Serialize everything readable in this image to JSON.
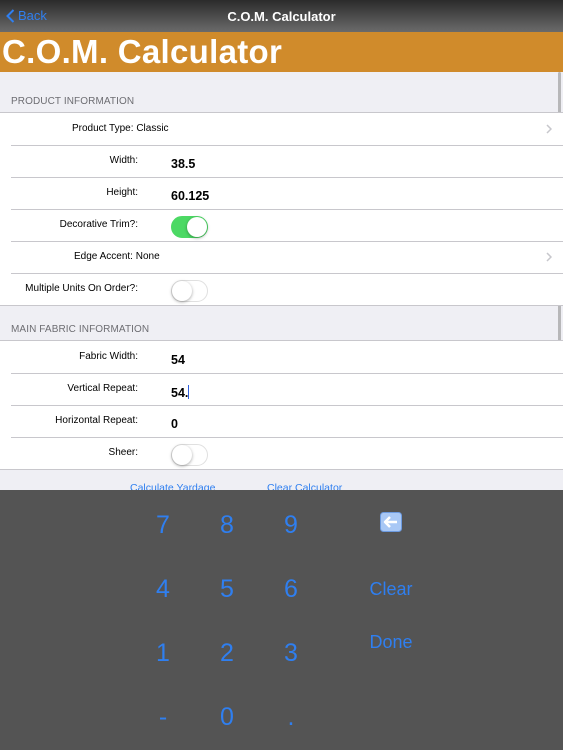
{
  "navbar": {
    "back_label": "Back",
    "title": "C.O.M. Calculator"
  },
  "banner": {
    "title": "C.O.M. Calculator",
    "color": "#d08b2b"
  },
  "product_section": {
    "header": "PRODUCT INFORMATION",
    "product_type_label": "Product Type:",
    "product_type_value": "Classic",
    "width_label": "Width:",
    "width_value": "38.5",
    "height_label": "Height:",
    "height_value": "60.125",
    "decorative_trim_label": "Decorative Trim?:",
    "decorative_trim_on": true,
    "edge_accent_label": "Edge Accent:",
    "edge_accent_value": "None",
    "multiple_units_label": "Multiple Units On Order?:",
    "multiple_units_on": false
  },
  "fabric_section": {
    "header": "MAIN FABRIC INFORMATION",
    "fabric_width_label": "Fabric Width:",
    "fabric_width_value": "54",
    "vertical_repeat_label": "Vertical Repeat:",
    "vertical_repeat_value": "54.",
    "horizontal_repeat_label": "Horizontal Repeat:",
    "horizontal_repeat_value": "0",
    "sheer_label": "Sheer:",
    "sheer_on": false
  },
  "actions": {
    "calculate_label": "Calculate Yardage",
    "clear_label": "Clear Calculator"
  },
  "keypad": {
    "keys": [
      "7",
      "8",
      "9",
      "4",
      "5",
      "6",
      "1",
      "2",
      "3",
      "-",
      "0",
      "."
    ],
    "clear_label": "Clear",
    "done_label": "Done",
    "backspace_icon": "backspace-icon"
  },
  "colors": {
    "accent": "#2f7ff0",
    "toggle_on": "#4cd964",
    "keypad_bg": "#545454"
  }
}
